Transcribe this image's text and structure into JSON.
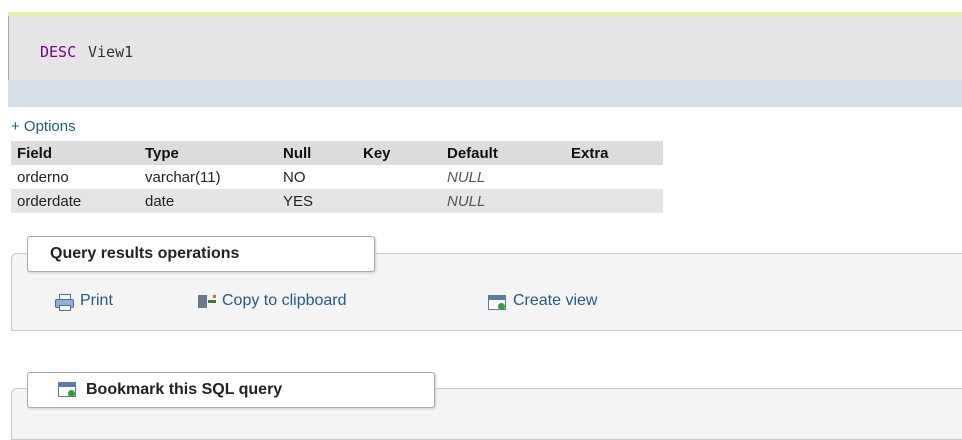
{
  "sql": {
    "keyword": "DESC",
    "text": "View1"
  },
  "options_link": "+ Options",
  "table": {
    "headers": [
      "Field",
      "Type",
      "Null",
      "Key",
      "Default",
      "Extra"
    ],
    "rows": [
      [
        "orderno",
        "varchar(11)",
        "NO",
        "",
        "NULL",
        ""
      ],
      [
        "orderdate",
        "date",
        "YES",
        "",
        "NULL",
        ""
      ]
    ]
  },
  "query_ops": {
    "legend": "Query results operations",
    "print": "Print",
    "copy": "Copy to clipboard",
    "create_view": "Create view"
  },
  "bookmark": {
    "legend": "Bookmark this SQL query"
  },
  "icons": {
    "print": "printer-icon",
    "copy": "copy-clipboard-icon",
    "create_view": "create-view-icon",
    "bookmark": "bookmark-icon"
  }
}
